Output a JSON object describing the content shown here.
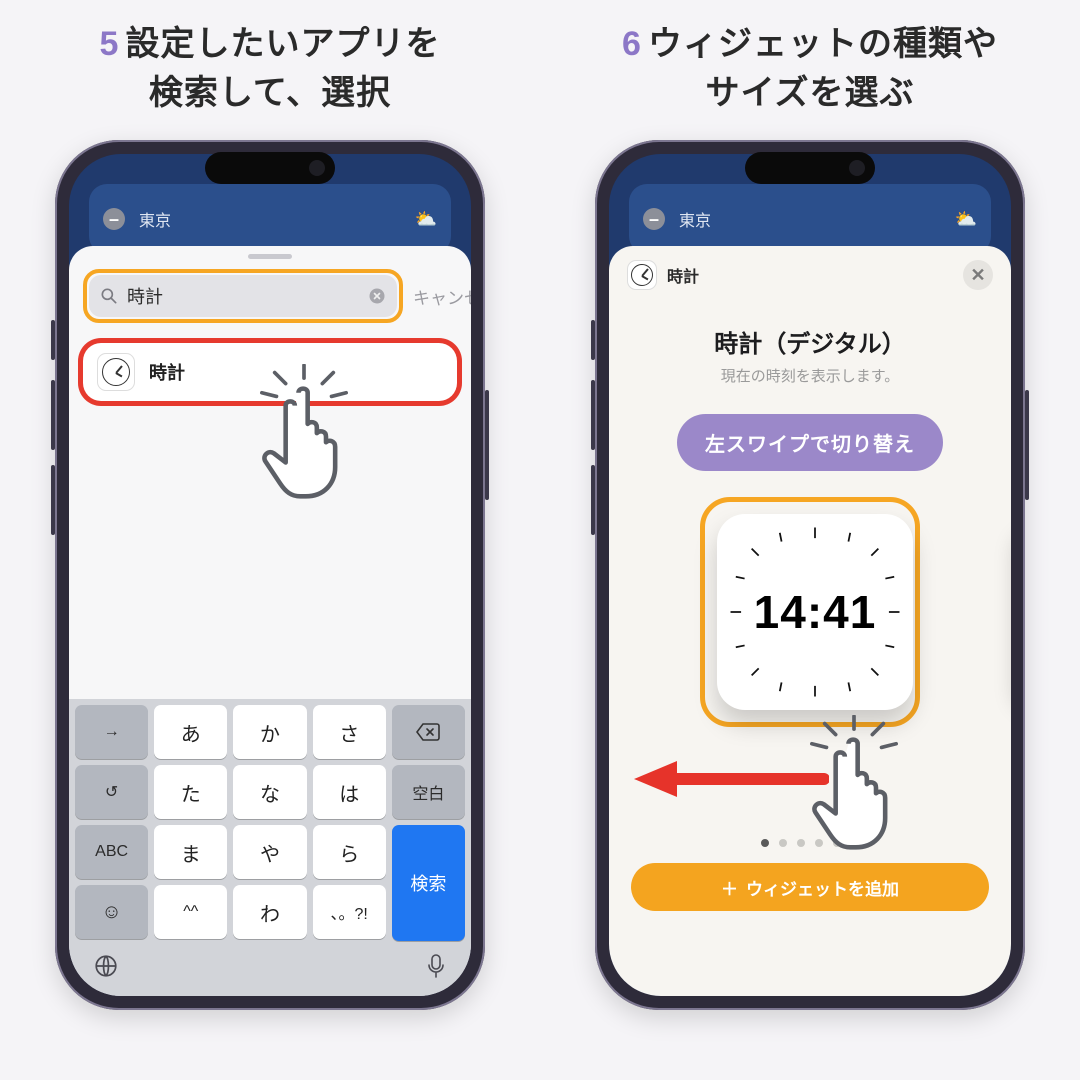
{
  "steps": {
    "left": {
      "num": "5",
      "text": "設定したいアプリを\n検索して、選択"
    },
    "right": {
      "num": "6",
      "text": "ウィジェットの種類や\nサイズを選ぶ"
    }
  },
  "background_widget": {
    "city": "東京",
    "weather_glyph": "⛅"
  },
  "search": {
    "value": "時計",
    "placeholder": "",
    "cancel": "キャンセル",
    "result_label": "時計"
  },
  "keyboard": {
    "row1": [
      "→",
      "あ",
      "か",
      "さ",
      "⌫"
    ],
    "row2": [
      "↺",
      "た",
      "な",
      "は",
      "空白"
    ],
    "row3_left": [
      "ABC",
      "ま",
      "や",
      "ら"
    ],
    "row4_left": [
      "☺",
      "^^",
      "わ",
      "、。?!"
    ],
    "search_key": "検索",
    "globe": "🌐",
    "mic": "🎤"
  },
  "picker": {
    "app_name": "時計",
    "title": "時計（デジタル）",
    "subtitle": "現在の時刻を表示します。",
    "hint_pill": "左スワイプで切り替え",
    "time": "14:41",
    "page_count": 6,
    "active_page": 0,
    "add_button": "ウィジェットを追加"
  },
  "icons": {
    "plus": "＋"
  }
}
